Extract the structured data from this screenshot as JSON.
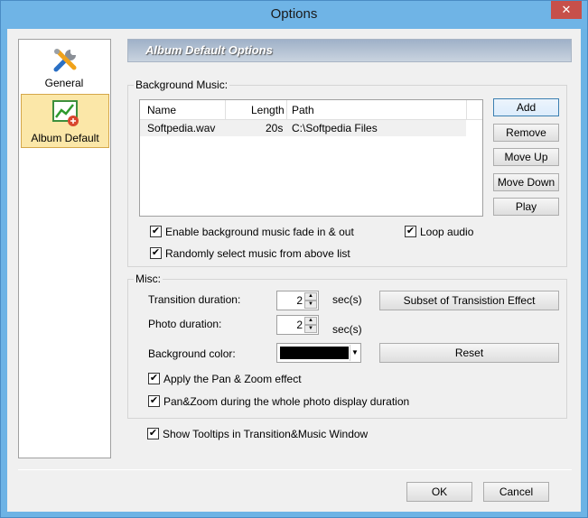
{
  "window": {
    "title": "Options",
    "close_glyph": "✕"
  },
  "sidebar": {
    "items": [
      {
        "label": "General",
        "icon": "tools-icon"
      },
      {
        "label": "Album Default",
        "icon": "chart-icon",
        "selected": true
      }
    ]
  },
  "header": {
    "title": "Album Default Options"
  },
  "background_music": {
    "group_title": "Background Music:",
    "columns": [
      "Name",
      "Length",
      "Path"
    ],
    "rows": [
      {
        "name": "Softpedia.wav",
        "length": "20s",
        "path": "C:\\Softpedia Files"
      }
    ],
    "buttons": {
      "add": "Add",
      "remove": "Remove",
      "move_up": "Move Up",
      "move_down": "Move Down",
      "play": "Play"
    },
    "fade": {
      "label": "Enable background music fade in & out",
      "checked": true
    },
    "loop": {
      "label": "Loop audio",
      "checked": true
    },
    "random": {
      "label": "Randomly select music from above list",
      "checked": true
    }
  },
  "misc": {
    "group_title": "Misc:",
    "transition_label": "Transition duration:",
    "transition_value": "2",
    "transition_unit": "sec(s)",
    "photo_label": "Photo duration:",
    "photo_value": "2",
    "photo_unit": "sec(s)",
    "bg_color_label": "Background color:",
    "bg_color_value": "#000000",
    "subset_button": "Subset of Transistion Effect",
    "reset_button": "Reset",
    "pan_zoom": {
      "label": "Apply the Pan & Zoom effect",
      "checked": true
    },
    "pan_zoom_whole": {
      "label": "Pan&Zoom during the whole photo display duration",
      "checked": true
    }
  },
  "tooltips": {
    "label": "Show Tooltips in Transition&Music Window",
    "checked": true
  },
  "footer": {
    "ok": "OK",
    "cancel": "Cancel"
  },
  "check_glyph": "✔"
}
